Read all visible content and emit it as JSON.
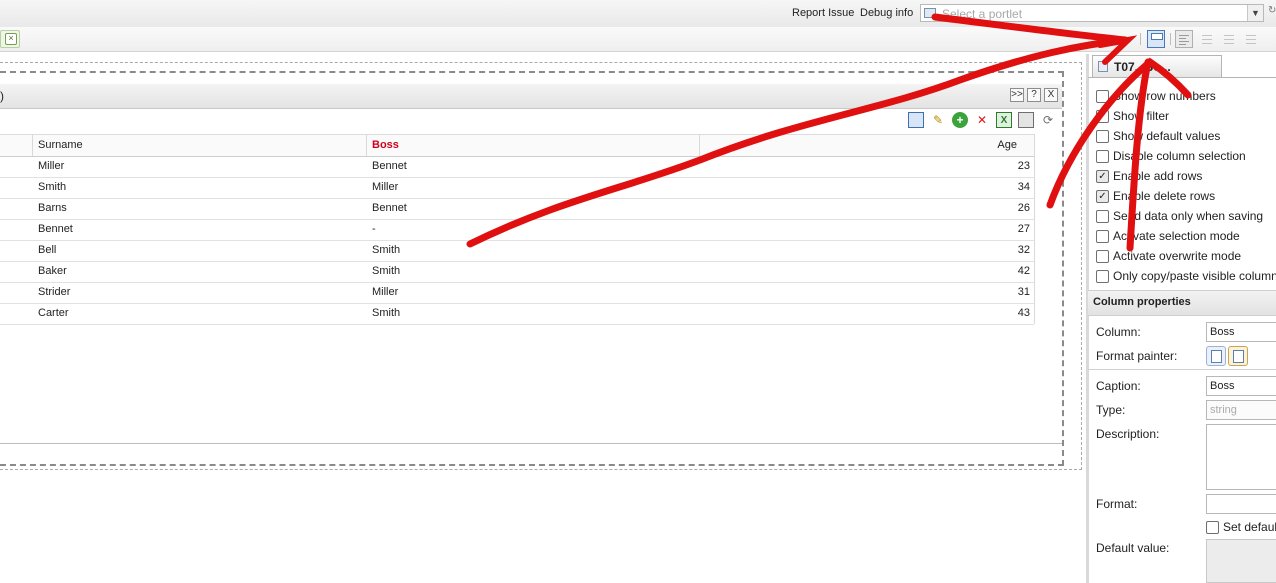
{
  "topbar": {
    "report_issue": "Report Issue",
    "debug_info": "Debug info",
    "portlet_select": {
      "placeholder": "Select a portlet"
    }
  },
  "portlet": {
    "title_fragment": ")",
    "header_buttons": [
      ">>",
      "?",
      "X"
    ],
    "toolbar_icons": [
      "save-icon",
      "edit-icon",
      "add-row-icon",
      "delete-icon",
      "excel-export-icon",
      "print-icon",
      "refresh-icon"
    ]
  },
  "grid": {
    "columns": [
      "Surname",
      "Boss",
      "Age"
    ],
    "boss_color": "#d0021b",
    "rows": [
      {
        "surname": "Miller",
        "boss": "Bennet",
        "age": "23"
      },
      {
        "surname": "Smith",
        "boss": "Miller",
        "age": "34"
      },
      {
        "surname": "Barns",
        "boss": "Bennet",
        "age": "26"
      },
      {
        "surname": "Bennet",
        "boss": "-",
        "age": "27"
      },
      {
        "surname": "Bell",
        "boss": "Smith",
        "age": "32"
      },
      {
        "surname": "Baker",
        "boss": "Smith",
        "age": "42"
      },
      {
        "surname": "Strider",
        "boss": "Miller",
        "age": "31"
      },
      {
        "surname": "Carter",
        "boss": "Smith",
        "age": "43"
      }
    ]
  },
  "right_panel": {
    "tab_label": "T07...Bo...",
    "options": [
      {
        "label": "Show row numbers",
        "checked": false
      },
      {
        "label": "Show filter",
        "checked": false
      },
      {
        "label": "Show default values",
        "checked": false
      },
      {
        "label": "Disable column selection",
        "checked": false
      },
      {
        "label": "Enable add rows",
        "checked": true
      },
      {
        "label": "Enable delete rows",
        "checked": true
      },
      {
        "label": "Send data only when saving",
        "checked": false
      },
      {
        "label": "Activate selection mode",
        "checked": false
      },
      {
        "label": "Activate overwrite mode",
        "checked": false
      },
      {
        "label": "Only copy/paste visible columns",
        "checked": false
      }
    ],
    "column_properties": {
      "title": "Column properties",
      "column_label": "Column:",
      "column_value": "Boss",
      "format_painter_label": "Format painter:",
      "caption_label": "Caption:",
      "caption_value": "Boss",
      "type_label": "Type:",
      "type_value": "string",
      "description_label": "Description:",
      "format_label": "Format:",
      "set_default_label": "Set default",
      "default_value_label": "Default value:"
    }
  },
  "annotation": {
    "arrow_color": "#e01010"
  }
}
